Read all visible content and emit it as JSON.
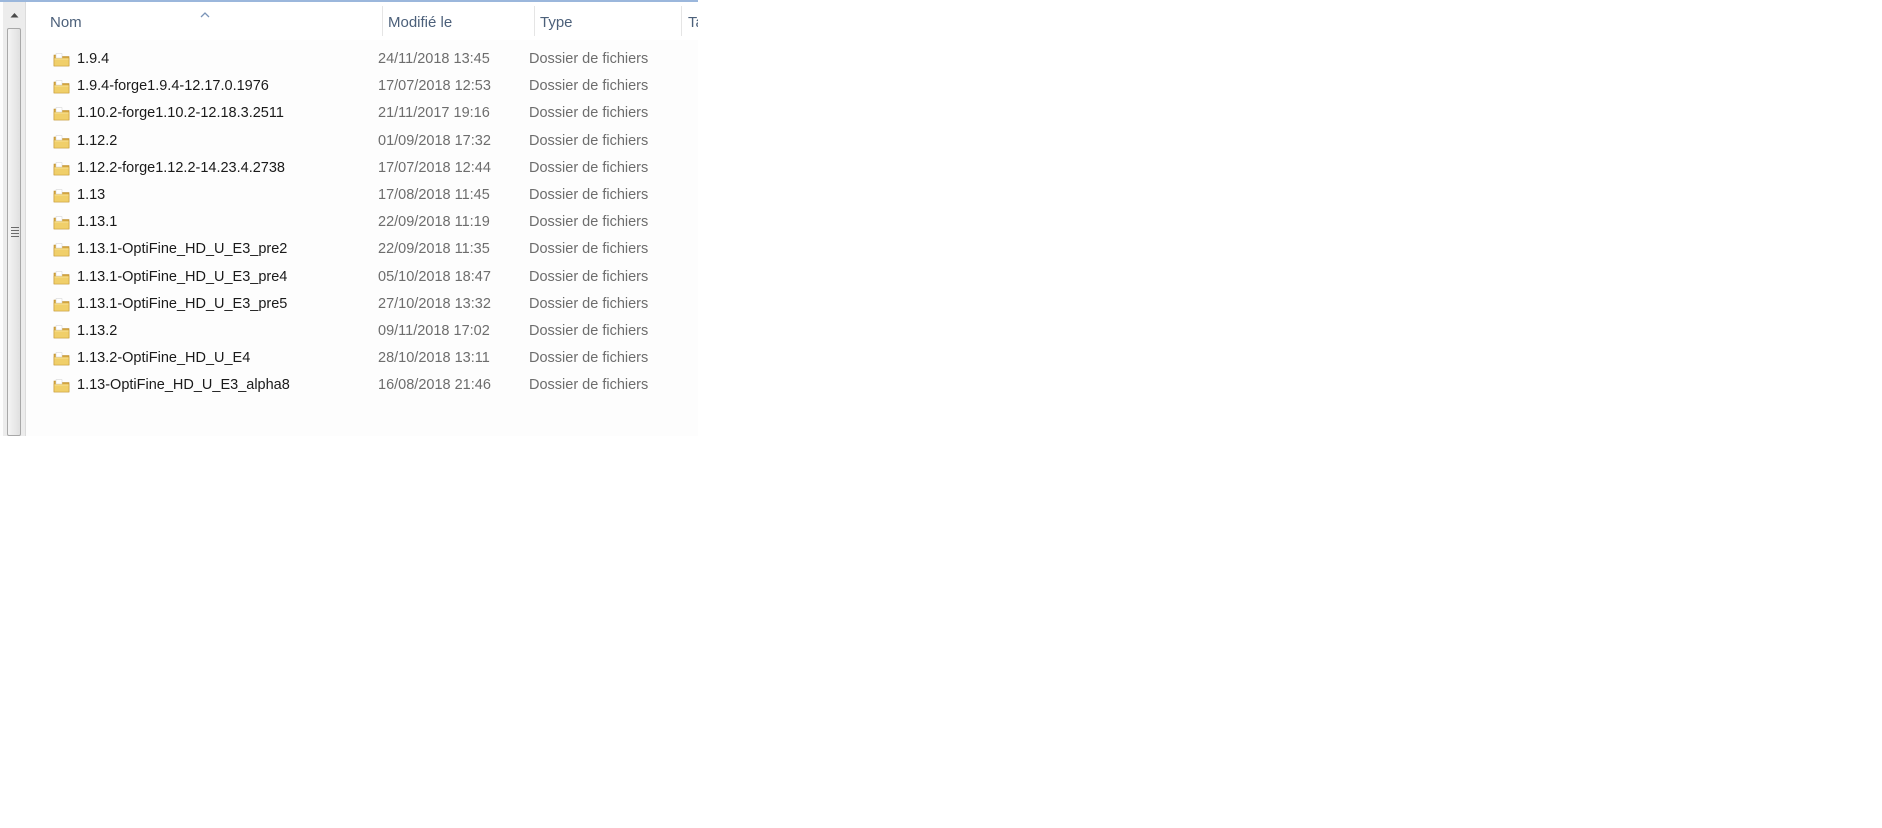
{
  "header": {
    "columns": [
      {
        "label": "Nom"
      },
      {
        "label": "Modifié le"
      },
      {
        "label": "Type"
      },
      {
        "label": "Tai"
      }
    ]
  },
  "icons": {
    "folder": "folder-icon",
    "sort": "sort-ascending-arrow-icon",
    "scroll_up": "scroll-up-arrow-icon",
    "grip": "scrollbar-grip-icon"
  },
  "colors": {
    "header_text": "#4c607a",
    "folder_yellow": "#e8c15a",
    "selection_line": "#9bb7dc"
  },
  "files": [
    {
      "name": "1.9.4",
      "date": "24/11/2018 13:45",
      "type": "Dossier de fichiers"
    },
    {
      "name": "1.9.4-forge1.9.4-12.17.0.1976",
      "date": "17/07/2018 12:53",
      "type": "Dossier de fichiers"
    },
    {
      "name": "1.10.2-forge1.10.2-12.18.3.2511",
      "date": "21/11/2017 19:16",
      "type": "Dossier de fichiers"
    },
    {
      "name": "1.12.2",
      "date": "01/09/2018 17:32",
      "type": "Dossier de fichiers"
    },
    {
      "name": "1.12.2-forge1.12.2-14.23.4.2738",
      "date": "17/07/2018 12:44",
      "type": "Dossier de fichiers"
    },
    {
      "name": "1.13",
      "date": "17/08/2018 11:45",
      "type": "Dossier de fichiers"
    },
    {
      "name": "1.13.1",
      "date": "22/09/2018 11:19",
      "type": "Dossier de fichiers"
    },
    {
      "name": "1.13.1-OptiFine_HD_U_E3_pre2",
      "date": "22/09/2018 11:35",
      "type": "Dossier de fichiers"
    },
    {
      "name": "1.13.1-OptiFine_HD_U_E3_pre4",
      "date": "05/10/2018 18:47",
      "type": "Dossier de fichiers"
    },
    {
      "name": "1.13.1-OptiFine_HD_U_E3_pre5",
      "date": "27/10/2018 13:32",
      "type": "Dossier de fichiers"
    },
    {
      "name": "1.13.2",
      "date": "09/11/2018 17:02",
      "type": "Dossier de fichiers"
    },
    {
      "name": "1.13.2-OptiFine_HD_U_E4",
      "date": "28/10/2018 13:11",
      "type": "Dossier de fichiers"
    },
    {
      "name": "1.13-OptiFine_HD_U_E3_alpha8",
      "date": "16/08/2018 21:46",
      "type": "Dossier de fichiers"
    }
  ]
}
